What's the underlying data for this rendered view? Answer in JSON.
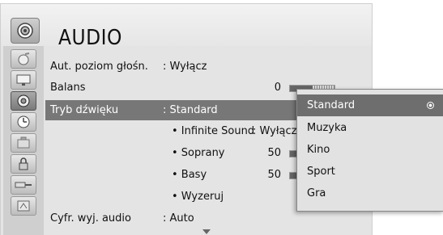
{
  "title": "AUDIO",
  "menu": {
    "aut_label": "Aut. poziom głośn.",
    "aut_value": ": Wyłącz",
    "balans_label": "Balans",
    "balans_value": "0",
    "tryb_label": "Tryb dźwięku",
    "tryb_value": ": Standard",
    "infinite_label": "• Infinite Sound",
    "infinite_value": ": Wyłącz",
    "soprany_label": "• Soprany",
    "soprany_value": "50",
    "basy_label": "• Basy",
    "basy_value": "50",
    "wyzeruj_label": "• Wyzeruj",
    "cyfr_label": "Cyfr. wyj. audio",
    "cyfr_value": ": Auto"
  },
  "levels": {
    "soprany_fraction": 0.5,
    "basy_fraction": 0.5,
    "balans_fraction": 0.5
  },
  "popup": {
    "options": [
      "Standard",
      "Muzyka",
      "Kino",
      "Sport",
      "Gra"
    ],
    "selected": "Standard"
  },
  "sidebar_icons": [
    "picture-icon",
    "screen-icon",
    "audio-icon",
    "clock-icon",
    "options-icon",
    "lock-icon",
    "input-icon",
    "usb-icon"
  ]
}
